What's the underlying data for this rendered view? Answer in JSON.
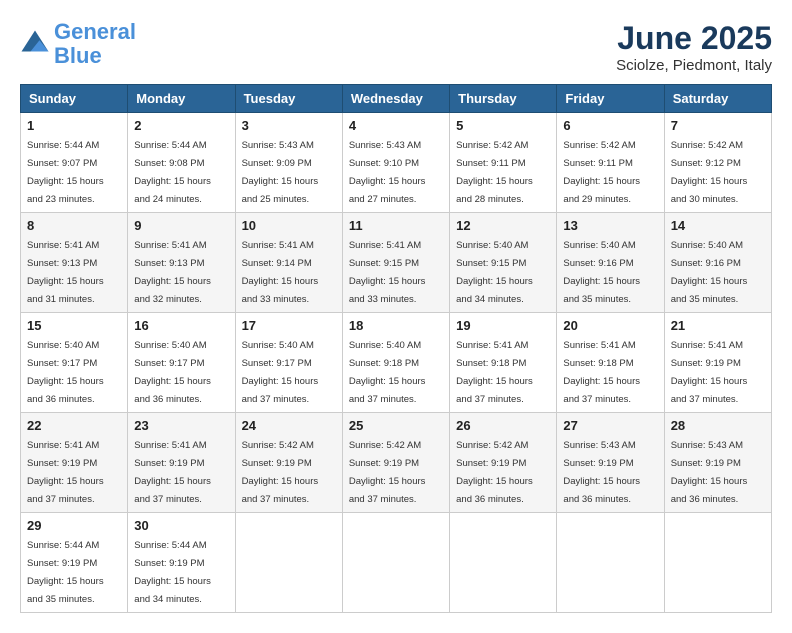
{
  "header": {
    "logo_line1": "General",
    "logo_line2": "Blue",
    "month": "June 2025",
    "location": "Sciolze, Piedmont, Italy"
  },
  "weekdays": [
    "Sunday",
    "Monday",
    "Tuesday",
    "Wednesday",
    "Thursday",
    "Friday",
    "Saturday"
  ],
  "weeks": [
    [
      {
        "day": "1",
        "sunrise": "5:44 AM",
        "sunset": "9:07 PM",
        "daylight": "15 hours and 23 minutes."
      },
      {
        "day": "2",
        "sunrise": "5:44 AM",
        "sunset": "9:08 PM",
        "daylight": "15 hours and 24 minutes."
      },
      {
        "day": "3",
        "sunrise": "5:43 AM",
        "sunset": "9:09 PM",
        "daylight": "15 hours and 25 minutes."
      },
      {
        "day": "4",
        "sunrise": "5:43 AM",
        "sunset": "9:10 PM",
        "daylight": "15 hours and 27 minutes."
      },
      {
        "day": "5",
        "sunrise": "5:42 AM",
        "sunset": "9:11 PM",
        "daylight": "15 hours and 28 minutes."
      },
      {
        "day": "6",
        "sunrise": "5:42 AM",
        "sunset": "9:11 PM",
        "daylight": "15 hours and 29 minutes."
      },
      {
        "day": "7",
        "sunrise": "5:42 AM",
        "sunset": "9:12 PM",
        "daylight": "15 hours and 30 minutes."
      }
    ],
    [
      {
        "day": "8",
        "sunrise": "5:41 AM",
        "sunset": "9:13 PM",
        "daylight": "15 hours and 31 minutes."
      },
      {
        "day": "9",
        "sunrise": "5:41 AM",
        "sunset": "9:13 PM",
        "daylight": "15 hours and 32 minutes."
      },
      {
        "day": "10",
        "sunrise": "5:41 AM",
        "sunset": "9:14 PM",
        "daylight": "15 hours and 33 minutes."
      },
      {
        "day": "11",
        "sunrise": "5:41 AM",
        "sunset": "9:15 PM",
        "daylight": "15 hours and 33 minutes."
      },
      {
        "day": "12",
        "sunrise": "5:40 AM",
        "sunset": "9:15 PM",
        "daylight": "15 hours and 34 minutes."
      },
      {
        "day": "13",
        "sunrise": "5:40 AM",
        "sunset": "9:16 PM",
        "daylight": "15 hours and 35 minutes."
      },
      {
        "day": "14",
        "sunrise": "5:40 AM",
        "sunset": "9:16 PM",
        "daylight": "15 hours and 35 minutes."
      }
    ],
    [
      {
        "day": "15",
        "sunrise": "5:40 AM",
        "sunset": "9:17 PM",
        "daylight": "15 hours and 36 minutes."
      },
      {
        "day": "16",
        "sunrise": "5:40 AM",
        "sunset": "9:17 PM",
        "daylight": "15 hours and 36 minutes."
      },
      {
        "day": "17",
        "sunrise": "5:40 AM",
        "sunset": "9:17 PM",
        "daylight": "15 hours and 37 minutes."
      },
      {
        "day": "18",
        "sunrise": "5:40 AM",
        "sunset": "9:18 PM",
        "daylight": "15 hours and 37 minutes."
      },
      {
        "day": "19",
        "sunrise": "5:41 AM",
        "sunset": "9:18 PM",
        "daylight": "15 hours and 37 minutes."
      },
      {
        "day": "20",
        "sunrise": "5:41 AM",
        "sunset": "9:18 PM",
        "daylight": "15 hours and 37 minutes."
      },
      {
        "day": "21",
        "sunrise": "5:41 AM",
        "sunset": "9:19 PM",
        "daylight": "15 hours and 37 minutes."
      }
    ],
    [
      {
        "day": "22",
        "sunrise": "5:41 AM",
        "sunset": "9:19 PM",
        "daylight": "15 hours and 37 minutes."
      },
      {
        "day": "23",
        "sunrise": "5:41 AM",
        "sunset": "9:19 PM",
        "daylight": "15 hours and 37 minutes."
      },
      {
        "day": "24",
        "sunrise": "5:42 AM",
        "sunset": "9:19 PM",
        "daylight": "15 hours and 37 minutes."
      },
      {
        "day": "25",
        "sunrise": "5:42 AM",
        "sunset": "9:19 PM",
        "daylight": "15 hours and 37 minutes."
      },
      {
        "day": "26",
        "sunrise": "5:42 AM",
        "sunset": "9:19 PM",
        "daylight": "15 hours and 36 minutes."
      },
      {
        "day": "27",
        "sunrise": "5:43 AM",
        "sunset": "9:19 PM",
        "daylight": "15 hours and 36 minutes."
      },
      {
        "day": "28",
        "sunrise": "5:43 AM",
        "sunset": "9:19 PM",
        "daylight": "15 hours and 36 minutes."
      }
    ],
    [
      {
        "day": "29",
        "sunrise": "5:44 AM",
        "sunset": "9:19 PM",
        "daylight": "15 hours and 35 minutes."
      },
      {
        "day": "30",
        "sunrise": "5:44 AM",
        "sunset": "9:19 PM",
        "daylight": "15 hours and 34 minutes."
      },
      null,
      null,
      null,
      null,
      null
    ]
  ]
}
